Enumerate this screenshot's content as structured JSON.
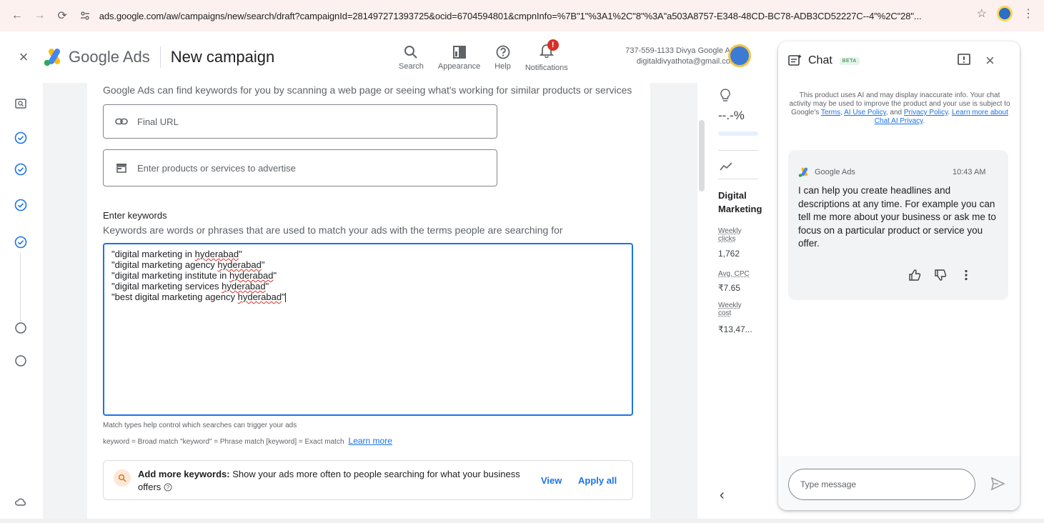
{
  "browser": {
    "url": "ads.google.com/aw/campaigns/new/search/draft?campaignId=281497271393725&ocid=6704594801&cmpnInfo=%7B\"1\"%3A1%2C\"8\"%3A\"a503A8757-E348-48CD-BC78-ADB3CD52227C--4\"%2C\"28\"..."
  },
  "header": {
    "brand": "Google Ads",
    "page_title": "New campaign",
    "tools": [
      {
        "label": "Search",
        "icon": "search-icon"
      },
      {
        "label": "Appearance",
        "icon": "appearance-icon"
      },
      {
        "label": "Help",
        "icon": "help-icon"
      },
      {
        "label": "Notifications",
        "icon": "notification-bell-icon"
      }
    ],
    "notification_badge": "!",
    "account_line1": "737-559-1133 Divya Google A...",
    "account_line2": "digitaldivyathota@gmail.com"
  },
  "form": {
    "hint": "Google Ads can find keywords for you by scanning a web page or seeing what's working for similar products or services",
    "final_url_placeholder": "Final URL",
    "products_placeholder": "Enter products or services to advertise",
    "keywords_title": "Enter keywords",
    "keywords_desc": "Keywords are words or phrases that are used to match your ads with the terms people are searching for",
    "keywords": [
      {
        "pre": "\"digital marketing in ",
        "sq": "hyderabad",
        "post": "\""
      },
      {
        "pre": "\"digital marketing agency ",
        "sq": "hyderabad",
        "post": "\""
      },
      {
        "pre": "\"digital marketing institute in ",
        "sq": "hyderabad",
        "post": "\""
      },
      {
        "pre": "\"digital marketing services ",
        "sq": "hyderabad",
        "post": "\""
      },
      {
        "pre": "\"best digital marketing agency ",
        "sq": "hyderabad",
        "post": "\""
      }
    ],
    "match_hint": "Match types help control which searches can trigger your ads",
    "match_legend": "keyword = Broad match  \"keyword\" = Phrase match  [keyword] = Exact match",
    "learn_more": "Learn more",
    "suggestion_bold": "Add more keywords:",
    "suggestion_text": " Show your ads more often to people searching for what your business offers",
    "suggestion_view": "View",
    "suggestion_apply_all": "Apply all"
  },
  "estimate": {
    "percent": "--.-%",
    "title_line1": "Digital",
    "title_line2": "Marketing",
    "weekly_clicks_label1": "Weekly",
    "weekly_clicks_label2": "clicks",
    "weekly_clicks_value": "1,762",
    "avg_cpc_label": "Avg. CPC",
    "avg_cpc_value": "₹7.65",
    "weekly_cost_label1": "Weekly",
    "weekly_cost_label2": "cost",
    "weekly_cost_value": "₹13,47..."
  },
  "chat": {
    "title": "Chat",
    "beta": "BETA",
    "disclaimer_pre": "This product uses AI and may display inaccurate info. Your chat activity may be used to improve the product and your use is subject to Google's ",
    "terms": "Terms",
    "ai_policy": "AI Use Policy",
    "and": ", and ",
    "privacy": "Privacy Policy",
    "learn_more": "Learn more about Chat AI Privacy",
    "sender": "Google Ads",
    "time": "10:43 AM",
    "message": "I can help you create headlines and descriptions at any time. For example you can tell me more about your business or ask me to focus on a particular product or service you offer.",
    "input_placeholder": "Type message"
  },
  "colors": {
    "accent": "#1a73e8",
    "browser_bar": "#fdf1ef",
    "step_done": "#1a73e8",
    "error": "#d93025"
  }
}
